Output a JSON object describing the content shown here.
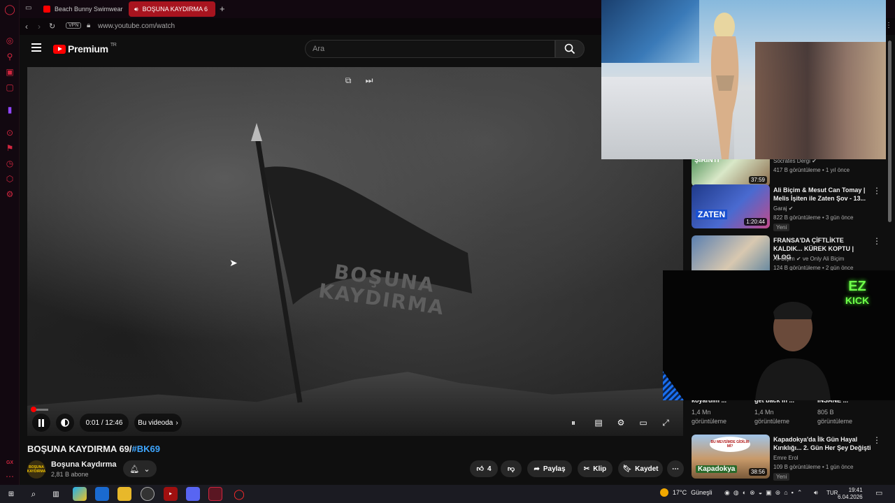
{
  "tabs": [
    {
      "label": "Beach Bunny Swimwear F",
      "active": false
    },
    {
      "label": "BOŞUNA KAYDIRMA 6",
      "active": true
    }
  ],
  "address": {
    "vpn": "VPN",
    "url": "www.youtube.com/watch"
  },
  "header": {
    "brand": "Premium",
    "region": "TR",
    "search_placeholder": "Ara"
  },
  "player": {
    "time": "0:01 / 12:46",
    "chapter": "Bu videoda",
    "progress_fraction": 0.0013,
    "flag_text_line1": "BOŞUNA",
    "flag_text_line2": "KAYDIRMA"
  },
  "video": {
    "title_main": "BOŞUNA KAYDIRMA 69/",
    "title_hashtag": "#BK69",
    "channel_name": "Boşuna Kaydırma",
    "channel_subs": "2,81 B abone",
    "channel_avatar_text": "BOŞUNA KAYDIRMA"
  },
  "actions": {
    "likes": "4",
    "share": "Paylaş",
    "clip": "Klip",
    "save": "Kaydet"
  },
  "related": [
    {
      "title": "",
      "channel": "Socrates Dergi",
      "meta": "417 B görüntüleme • 1 yıl önce",
      "duration": "37:59",
      "thumb_text": "ŞIRINTI",
      "new": ""
    },
    {
      "title": "Ali Biçim & Mesut Can Tomay | Melis İşiten ile Zaten Şov - 13...",
      "channel": "Garaj",
      "meta": "822 B görüntüleme • 3 gün önce",
      "duration": "1:20:44",
      "thumb_text": "ZATEN",
      "new": "Yeni"
    },
    {
      "title": "FRANSA'DA ÇİFTLİKTE KALDIK... KÜREK KOPTU | VLOG",
      "channel": "Ali Biçim",
      "channel_extra": "ve Only Ali Biçim",
      "meta": "124 B görüntüleme • 2 gün önce",
      "duration": "",
      "thumb_text": "",
      "new": ""
    },
    {
      "title": "Kapadokya'da İlk Gün Hayal Kırıklığı... 2. Gün Her Şey Değişti",
      "channel": "Emre Erol",
      "meta": "109 B görüntüleme • 1 gün önce",
      "duration": "38:56",
      "thumb_text": "Kapadokya",
      "thumb_banner": "BU MEVSİMDE GİDİLİR Mİ?",
      "new": "Yeni"
    }
  ],
  "grid_cards": [
    {
      "title": "koyardım ...",
      "views": "1,4 Mn",
      "views_label": "görüntüleme"
    },
    {
      "title": "get back in ...",
      "views": "1,4 Mn",
      "views_label": "görüntüleme"
    },
    {
      "title": "INSANE ...",
      "views": "805 B",
      "views_label": "görüntüleme"
    }
  ],
  "webcam": {
    "badge_line1": "EZ",
    "badge_line2": "KICK"
  },
  "taskbar": {
    "temperature": "17°C",
    "weather": "Güneşli",
    "language": "TUR",
    "time": "19:41",
    "date": "6.04.2026"
  },
  "colors": {
    "accent": "#ff0000",
    "opera_red": "#d0263f",
    "link": "#3ea6ff",
    "kick_green": "#6fff4a"
  }
}
